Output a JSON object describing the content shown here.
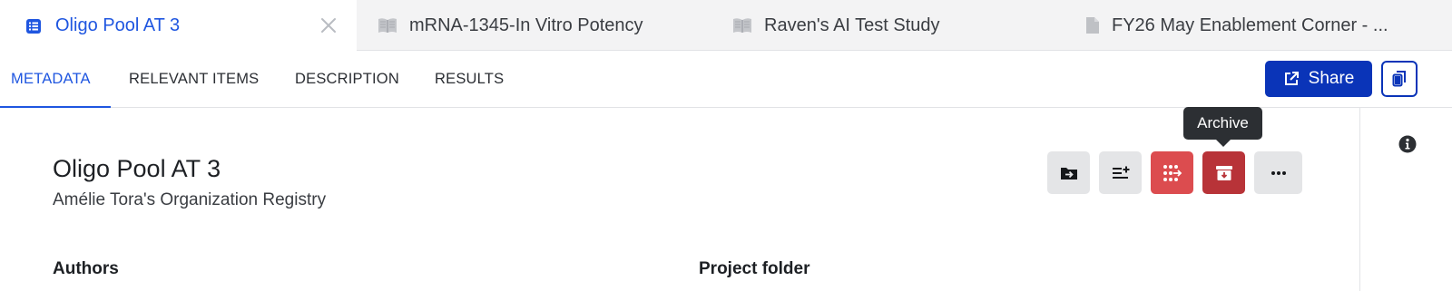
{
  "tabs": [
    {
      "label": "Oligo Pool AT 3",
      "icon": "list-icon",
      "active": true
    },
    {
      "label": "mRNA-1345-In Vitro Potency",
      "icon": "book-icon"
    },
    {
      "label": "Raven's AI Test Study",
      "icon": "book-icon"
    },
    {
      "label": "FY26 May Enablement Corner - ...",
      "icon": "document-icon"
    }
  ],
  "subnav": {
    "items": [
      "METADATA",
      "RELEVANT ITEMS",
      "DESCRIPTION",
      "RESULTS"
    ],
    "active": "METADATA",
    "share_label": "Share"
  },
  "entity": {
    "title": "Oligo Pool AT 3",
    "subtitle": "Amélie Tora's Organization Registry"
  },
  "actions": {
    "tooltip": "Archive",
    "buttons": [
      "move-to-folder-icon",
      "add-to-list-icon",
      "register-icon",
      "archive-icon",
      "more-icon"
    ]
  },
  "fields": {
    "authors_label": "Authors",
    "project_folder_label": "Project folder"
  },
  "colors": {
    "accent": "#1f56e0",
    "primary_button": "#0a34b8",
    "danger": "#dc4c4f",
    "danger_dark": "#b83338"
  }
}
